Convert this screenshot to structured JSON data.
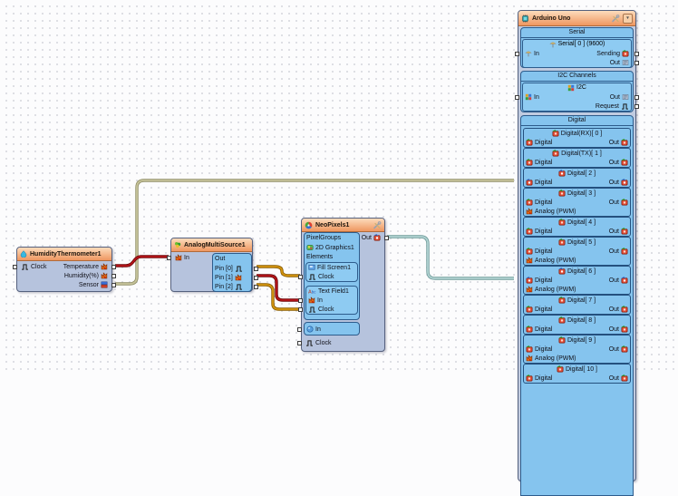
{
  "app": {
    "name_hint": "visual-arduino-designer-canvas"
  },
  "colors": {
    "header_orange": "#ef9760",
    "panel_blue": "#85c4ee",
    "body_lavender": "#b6c3dd",
    "wire_red": "#b61418",
    "wire_olive": "#c2bf94",
    "wire_gold": "#cf9010",
    "wire_teal": "#a8cccb"
  },
  "icons": {
    "clock-icon": "square-wave",
    "analog-icon": "orange-flame",
    "digital-pin-icon": "red-chip-green-arrow",
    "digital-connected-icon": "red-chip-blue-arrow",
    "sensor-icon": "blue-red-stack",
    "serial-antenna-icon": "antenna",
    "serial-out-icon": "gray-buffer",
    "i2c-icon": "four-color-grid",
    "graphics-icon": "green-palette",
    "fillscreen-icon": "blue-screen",
    "textfield-icon": "abc-letters",
    "sphere-icon": "blue-sphere",
    "wrench-icon": "crossed-tools",
    "chip-icon": "teal-chip",
    "drop-icon": "cyan-drop",
    "multisource-icon": "green-cluster",
    "colorwheel-icon": "rgb-wheel",
    "dropdown-icon": "down-triangle"
  },
  "blocks": {
    "humidity_thermometer": {
      "title": "HumidityThermometer1",
      "pin_clock": {
        "label": "Clock"
      },
      "pins_right": [
        {
          "label": "Temperature"
        },
        {
          "label": "Humidity(%)"
        },
        {
          "label": "Sensor"
        }
      ]
    },
    "analog_multi_source": {
      "title": "AnalogMultiSource1",
      "pin_in": {
        "label": "In"
      },
      "out_box": {
        "label": "Out",
        "pins": [
          {
            "label": "Pin [0]",
            "icon": "clock-icon"
          },
          {
            "label": "Pin [1]",
            "icon": "analog-icon"
          },
          {
            "label": "Pin [2]",
            "icon": "clock-icon"
          }
        ]
      }
    },
    "neopixels": {
      "title": "NeoPixels1",
      "out_pin": {
        "label": "Out"
      },
      "pixel_groups_label": "PixelGroups",
      "graphics_item": "2D Graphics1",
      "elements_label": "Elements",
      "fill_screen": {
        "title": "Fill Screen1",
        "pin_clock": "Clock"
      },
      "text_field": {
        "title": "Text Field1",
        "pin_in": "In",
        "pin_clock": "Clock"
      },
      "color_in_pin": {
        "label": "In"
      },
      "pin_clock": {
        "label": "Clock"
      }
    },
    "arduino": {
      "title": "Arduino Uno",
      "serial_section": {
        "title": "Serial",
        "channel_title": "Serial[ 0 ] (9600)",
        "pin_in": "In",
        "pin_sending": "Sending",
        "pin_out": "Out"
      },
      "i2c_section": {
        "title": "I2C Channels",
        "channel_title": "I2C",
        "pin_in": "In",
        "pin_out": "Out",
        "pin_request": "Request"
      },
      "digital_section": {
        "title": "Digital",
        "row_labels": {
          "digital": "Digital",
          "out": "Out",
          "analog_pwm": "Analog (PWM)"
        },
        "channels": [
          {
            "title": "Digital(RX)[ 0 ]",
            "pwm": false,
            "connected": false
          },
          {
            "title": "Digital(TX)[ 1 ]",
            "pwm": false,
            "connected": false
          },
          {
            "title": "Digital[ 2 ]",
            "pwm": false,
            "connected": true
          },
          {
            "title": "Digital[ 3 ]",
            "pwm": true,
            "connected": false
          },
          {
            "title": "Digital[ 4 ]",
            "pwm": false,
            "connected": false
          },
          {
            "title": "Digital[ 5 ]",
            "pwm": true,
            "connected": false
          },
          {
            "title": "Digital[ 6 ]",
            "pwm": true,
            "connected": true
          },
          {
            "title": "Digital[ 7 ]",
            "pwm": false,
            "connected": false
          },
          {
            "title": "Digital[ 8 ]",
            "pwm": false,
            "connected": false
          },
          {
            "title": "Digital[ 9 ]",
            "pwm": true,
            "connected": false
          },
          {
            "title": "Digital[ 10 ]",
            "pwm": false,
            "connected": false
          }
        ]
      }
    }
  },
  "connections": [
    {
      "from": "HumidityThermometer1.Temperature",
      "to": "AnalogMultiSource1.In",
      "color": "#b61418"
    },
    {
      "from": "HumidityThermometer1.Sensor",
      "to": "Arduino Uno.Digital[ 2 ].Digital",
      "color": "#c2bf94"
    },
    {
      "from": "AnalogMultiSource1.Pin [0]",
      "to": "NeoPixels1.Fill Screen1.Clock",
      "color": "#cf9010"
    },
    {
      "from": "AnalogMultiSource1.Pin [1]",
      "to": "NeoPixels1.Text Field1.In",
      "color": "#b61418"
    },
    {
      "from": "AnalogMultiSource1.Pin [2]",
      "to": "NeoPixels1.Text Field1.Clock",
      "color": "#cf9010"
    },
    {
      "from": "NeoPixels1.Out",
      "to": "Arduino Uno.Digital[ 6 ].Digital",
      "color": "#a8cccb"
    }
  ]
}
